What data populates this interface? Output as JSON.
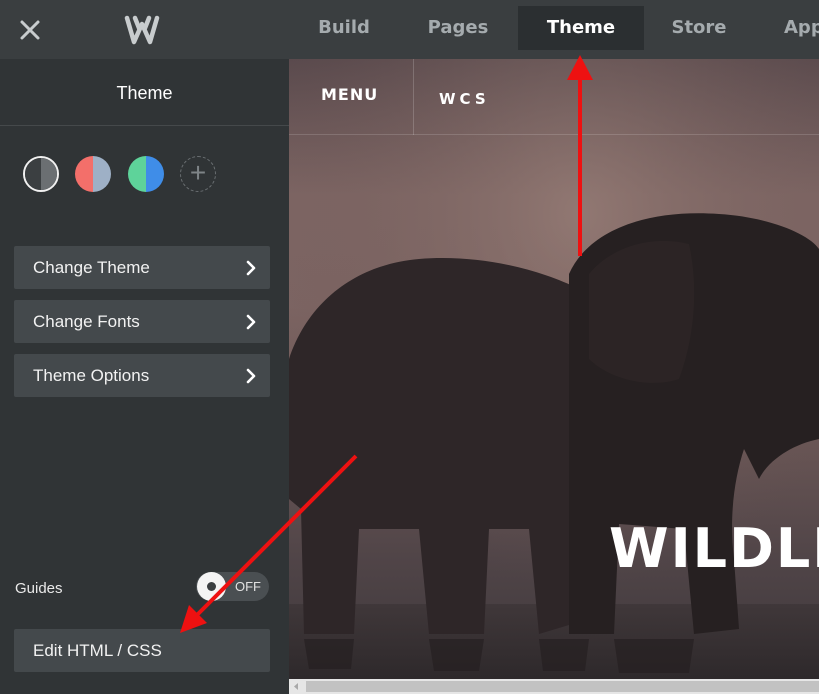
{
  "topbar": {
    "tabs": [
      {
        "label": "Build"
      },
      {
        "label": "Pages"
      },
      {
        "label": "Theme"
      },
      {
        "label": "Store"
      },
      {
        "label": "Apps"
      }
    ],
    "active_tab": "Theme"
  },
  "sidebar": {
    "title": "Theme",
    "swatches": [
      {
        "left": "#3b3f41",
        "right": "#6b6f72"
      },
      {
        "left": "#f36f6a",
        "right": "#9eb0c6"
      },
      {
        "left": "#5ed39a",
        "right": "#3f8de8"
      }
    ],
    "menu_items": [
      {
        "label": "Change Theme"
      },
      {
        "label": "Change Fonts"
      },
      {
        "label": "Theme Options"
      }
    ],
    "guides_label": "Guides",
    "guides_toggle": "OFF",
    "edit_html_label": "Edit HTML / CSS"
  },
  "preview": {
    "menu_label": "MENU",
    "brand": "WCS",
    "hero_title": "WILDLIF"
  },
  "icons": {
    "close": "close-icon",
    "logo": "weebly-logo-icon",
    "add": "plus-icon",
    "chevron": "chevron-right-icon"
  },
  "colors": {
    "topbar_bg": "#3a3e40",
    "sidebar_bg": "#303436",
    "button_bg": "#44494c",
    "annotation_arrow": "#ee1111"
  }
}
